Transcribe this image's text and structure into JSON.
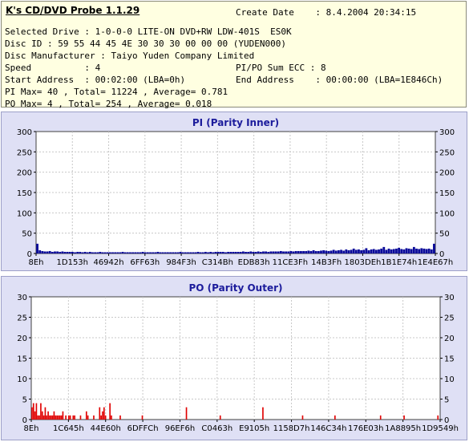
{
  "app": {
    "title": "K's CD/DVD Probe 1.1.29"
  },
  "info": {
    "create_date": "Create Date    : 8.4.2004 20:34:15",
    "selected_drive": "Selected Drive : 1-0-0-0 LITE-ON DVD+RW LDW-401S  ES0K",
    "disc_id": "Disc ID : 59 55 44 45 4E 30 30 30 00 00 00 (YUDEN000)",
    "disc_manufacturer": "Disc Manufacturer : Taiyo Yuden Company Limited",
    "speed": "Speed          : 4",
    "pipo_sum_ecc": "PI/PO Sum ECC : 8",
    "start_address": "Start Address  : 00:02:00 (LBA=0h)",
    "end_address": "End Address    : 00:00:00 (LBA=1E846Ch)",
    "pi_summary": "PI Max= 40 , Total= 11224 , Average= 0.781",
    "po_summary": "PO Max= 4 , Total= 254 , Average= 0.018"
  },
  "colors": {
    "pi_series": "#0b0b9a",
    "po_series": "#e00000",
    "panel_bg": "#dfe0f5",
    "title": "#1c1c9c"
  },
  "chart_data": [
    {
      "type": "bar",
      "title": "PI (Parity Inner)",
      "ylim": [
        0,
        300
      ],
      "yticks": [
        "300",
        "250",
        "200",
        "150",
        "100",
        "50",
        "0"
      ],
      "xticks": [
        "8Eh",
        "1D153h",
        "46942h",
        "6FF63h",
        "984F3h",
        "C314Bh",
        "EDB83h",
        "11CE3Fh",
        "14B3Fh",
        "1803DEh",
        "1B1E74h",
        "1E4E67h"
      ],
      "grid": true,
      "series": [
        {
          "values": [
            24,
            8,
            6,
            5,
            5,
            6,
            4,
            5,
            5,
            4,
            5,
            4,
            4,
            4,
            4,
            3,
            4,
            4,
            3,
            4,
            3,
            4,
            3,
            3,
            3,
            4,
            3,
            3,
            3,
            3,
            3,
            3,
            3,
            3,
            4,
            3,
            3,
            3,
            3,
            3,
            3,
            3,
            4,
            3,
            3,
            3,
            3,
            3,
            4,
            3,
            3,
            3,
            3,
            3,
            3,
            3,
            3,
            4,
            3,
            3,
            3,
            3,
            3,
            3,
            4,
            3,
            3,
            4,
            3,
            4,
            3,
            4,
            4,
            4,
            4,
            3,
            4,
            4,
            4,
            4,
            4,
            4,
            5,
            4,
            4,
            5,
            4,
            4,
            5,
            4,
            5,
            5,
            4,
            5,
            5,
            5,
            5,
            6,
            5,
            5,
            5,
            6,
            5,
            6,
            6,
            6,
            6,
            6,
            7,
            6,
            8,
            6,
            6,
            7,
            8,
            7,
            6,
            7,
            9,
            7,
            8,
            9,
            7,
            10,
            8,
            9,
            12,
            9,
            10,
            8,
            9,
            13,
            8,
            10,
            11,
            9,
            10,
            12,
            16,
            9,
            12,
            10,
            11,
            12,
            14,
            11,
            10,
            13,
            12,
            11,
            16,
            12,
            11,
            13,
            12,
            11,
            12,
            10,
            24
          ]
        }
      ]
    },
    {
      "type": "bar",
      "title": "PO (Parity Outer)",
      "ylim": [
        0,
        30
      ],
      "yticks": [
        "30",
        "25",
        "20",
        "15",
        "10",
        "5",
        "0"
      ],
      "xticks": [
        "8Eh",
        "1C645h",
        "44E60h",
        "6DFFCh",
        "96EF6h",
        "C0463h",
        "E9105h",
        "1158D7h",
        "146C34h",
        "176E03h",
        "1A8895h",
        "1D9549h"
      ],
      "grid": true,
      "series": [
        {
          "values": [
            3,
            4,
            2,
            4,
            1,
            1,
            4,
            2,
            1,
            3,
            1,
            2,
            1,
            1,
            1,
            2,
            1,
            1,
            1,
            1,
            1,
            2,
            0,
            1,
            0,
            1,
            1,
            0,
            1,
            1,
            0,
            0,
            0,
            1,
            0,
            0,
            0,
            2,
            1,
            0,
            0,
            0,
            1,
            0,
            0,
            0,
            3,
            1,
            2,
            3,
            1,
            0,
            0,
            4,
            1,
            0,
            0,
            0,
            0,
            0,
            1,
            0,
            0,
            0,
            0,
            0,
            0,
            0,
            0,
            0,
            0,
            0,
            0,
            0,
            0,
            1,
            0,
            0,
            0,
            0,
            0,
            0,
            0,
            0,
            0,
            0,
            0,
            0,
            0,
            0,
            0,
            0,
            0,
            0,
            0,
            0,
            0,
            0,
            0,
            0,
            0,
            0,
            0,
            0,
            0,
            3,
            0,
            0,
            0,
            0,
            0,
            0,
            0,
            0,
            0,
            0,
            0,
            0,
            0,
            0,
            0,
            0,
            0,
            0,
            0,
            0,
            0,
            0,
            1,
            0,
            0,
            0,
            0,
            0,
            0,
            0,
            0,
            0,
            0,
            0,
            0,
            0,
            0,
            0,
            0,
            0,
            0,
            0,
            0,
            0,
            0,
            0,
            0,
            0,
            0,
            0,
            0,
            3,
            0,
            0,
            0,
            0,
            0,
            0,
            0,
            0,
            0,
            0,
            0,
            0,
            0,
            0,
            0,
            0,
            0,
            0,
            0,
            0,
            0,
            0,
            0,
            0,
            0,
            0,
            1,
            0,
            0,
            0,
            0,
            0,
            0,
            0,
            0,
            0,
            0,
            0,
            0,
            0,
            0,
            0,
            0,
            0,
            0,
            0,
            0,
            0,
            1,
            0,
            0,
            0,
            0,
            0,
            0,
            0,
            0,
            0,
            0,
            0,
            0,
            0,
            0,
            0,
            0,
            0,
            0,
            0,
            0,
            0,
            0,
            0,
            0,
            0,
            0,
            0,
            0,
            0,
            0,
            1,
            0,
            0,
            0,
            0,
            0,
            0,
            0,
            0,
            0,
            0,
            0,
            0,
            0,
            0,
            0,
            1,
            0,
            0,
            0,
            0,
            0,
            0,
            0,
            0,
            0,
            0,
            0,
            0,
            0,
            0,
            0,
            0,
            0,
            0,
            0,
            0,
            0,
            0,
            1,
            0
          ]
        }
      ]
    }
  ]
}
